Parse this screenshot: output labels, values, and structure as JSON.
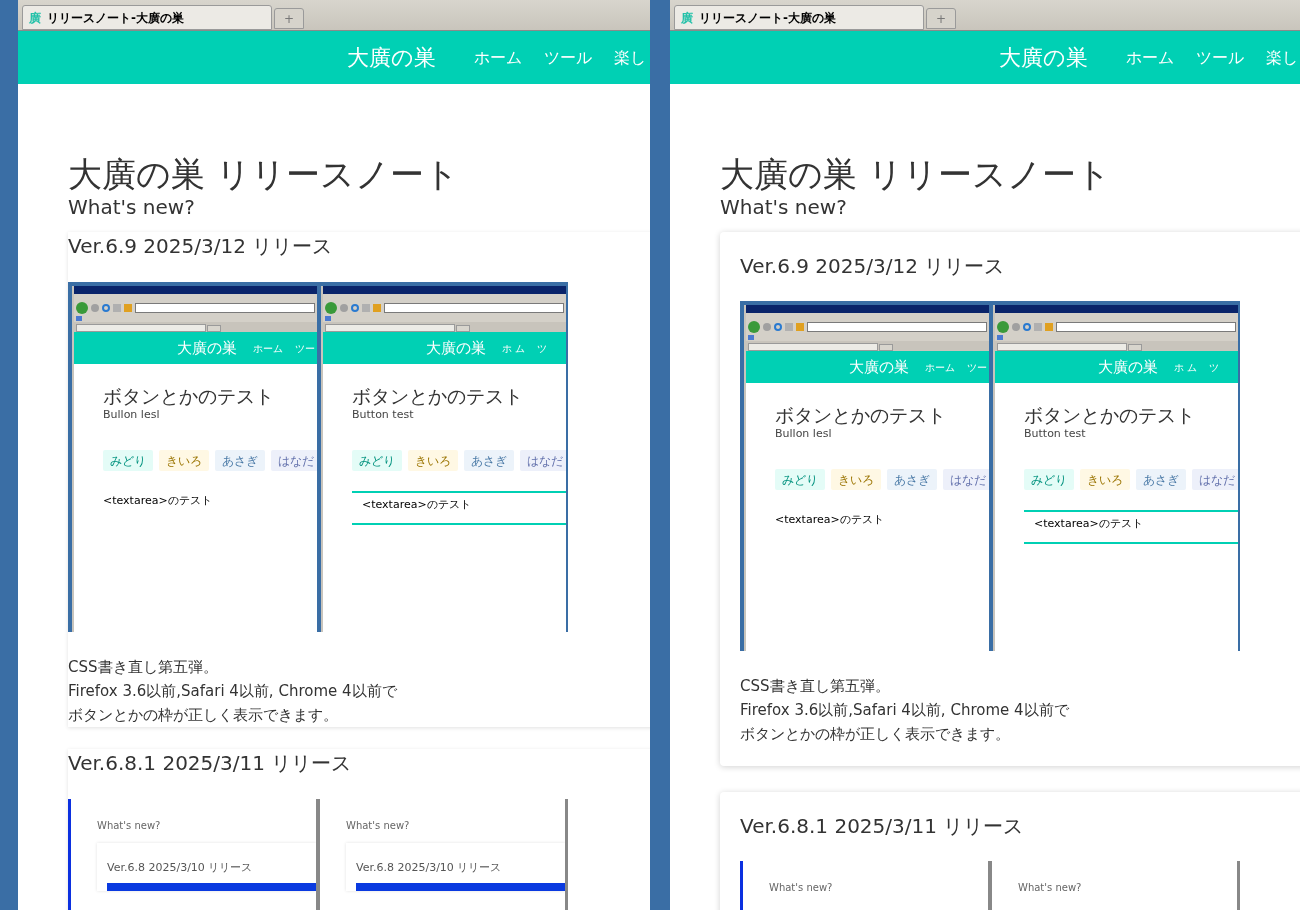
{
  "windows": [
    {
      "kind": "flush",
      "tab": {
        "icon": "廣",
        "title": "リリースノート-大廣の巣",
        "selected": true
      },
      "new_tab": "+",
      "header": {
        "site_title": "大廣の巣",
        "nav": [
          "ホーム",
          "ツール",
          "楽し"
        ]
      },
      "page": {
        "title": "大廣の巣 リリースノート",
        "subtitle": "What's new?",
        "releases": [
          {
            "heading": "Ver.6.9 2025/3/12 リリース",
            "screenshot": {
              "kind": "button-test",
              "windows": [
                {
                  "site_title": "大廣の巣",
                  "nav": [
                    "ホーム",
                    "ツー"
                  ],
                  "heading": "ボタンとかのテスト",
                  "subtitle": "Bullon lesl",
                  "buttons": [
                    {
                      "label": "みどり",
                      "color": "#e4fcf7"
                    },
                    {
                      "label": "きいろ",
                      "color": "#fff8e4"
                    },
                    {
                      "label": "あさぎ",
                      "color": "#ecf3fa"
                    },
                    {
                      "label": "はなだ",
                      "color": "#edf0fa"
                    }
                  ],
                  "textarea": {
                    "kind": "plain",
                    "text": "<textarea>のテスト"
                  }
                },
                {
                  "site_title": "大廣の巣",
                  "nav": [
                    "ホ ム",
                    "ツ"
                  ],
                  "heading": "ボタンとかのテスト",
                  "subtitle": "Button test",
                  "buttons": [
                    {
                      "label": "みどり",
                      "color": "#e4fcf7"
                    },
                    {
                      "label": "きいろ",
                      "color": "#fff8e4"
                    },
                    {
                      "label": "あさぎ",
                      "color": "#ecf3fa"
                    },
                    {
                      "label": "はなだ",
                      "color": "#edf0fa"
                    }
                  ],
                  "textarea": {
                    "kind": "field",
                    "text": "<textarea>のテスト"
                  }
                }
              ]
            },
            "notes": [
              "CSS書き直し第五弾。",
              "Firefox 3.6以前,Safari 4以前, Chrome 4以前で",
              "ボタンとかの枠が正しく表示できます。"
            ]
          },
          {
            "heading": "Ver.6.8.1 2025/3/11 リリース",
            "screenshot": {
              "kind": "release-note",
              "windows": [
                {
                  "subtitle": "What's new?",
                  "card_heading": "Ver.6.8 2025/3/10 リリース"
                },
                {
                  "subtitle": "What's new?",
                  "card_heading": "Ver.6.8 2025/3/10 リリース"
                }
              ]
            }
          }
        ]
      }
    },
    {
      "kind": "card",
      "tab": {
        "icon": "廣",
        "title": "リリースノート-大廣の巣",
        "selected": true
      },
      "new_tab": "+",
      "header": {
        "site_title": "大廣の巣",
        "nav": [
          "ホーム",
          "ツール",
          "楽し"
        ]
      },
      "page": {
        "title": "大廣の巣 リリースノート",
        "subtitle": "What's new?",
        "releases": [
          {
            "heading": "Ver.6.9 2025/3/12 リリース",
            "screenshot": {
              "kind": "button-test",
              "windows": [
                {
                  "site_title": "大廣の巣",
                  "nav": [
                    "ホーム",
                    "ツー"
                  ],
                  "heading": "ボタンとかのテスト",
                  "subtitle": "Bullon lesl",
                  "buttons": [
                    {
                      "label": "みどり",
                      "color": "#e4fcf7"
                    },
                    {
                      "label": "きいろ",
                      "color": "#fff8e4"
                    },
                    {
                      "label": "あさぎ",
                      "color": "#ecf3fa"
                    },
                    {
                      "label": "はなだ",
                      "color": "#edf0fa"
                    }
                  ],
                  "textarea": {
                    "kind": "plain",
                    "text": "<textarea>のテスト"
                  }
                },
                {
                  "site_title": "大廣の巣",
                  "nav": [
                    "ホ ム",
                    "ツ"
                  ],
                  "heading": "ボタンとかのテスト",
                  "subtitle": "Button test",
                  "buttons": [
                    {
                      "label": "みどり",
                      "color": "#e4fcf7"
                    },
                    {
                      "label": "きいろ",
                      "color": "#fff8e4"
                    },
                    {
                      "label": "あさぎ",
                      "color": "#ecf3fa"
                    },
                    {
                      "label": "はなだ",
                      "color": "#edf0fa"
                    }
                  ],
                  "textarea": {
                    "kind": "field",
                    "text": "<textarea>のテスト"
                  }
                }
              ]
            },
            "notes": [
              "CSS書き直し第五弾。",
              "Firefox 3.6以前,Safari 4以前, Chrome 4以前で",
              "ボタンとかの枠が正しく表示できます。"
            ]
          },
          {
            "heading": "Ver.6.8.1 2025/3/11 リリース",
            "screenshot": {
              "kind": "release-note",
              "windows": [
                {
                  "subtitle": "What's new?"
                },
                {
                  "subtitle": "What's new?"
                }
              ]
            }
          }
        ]
      }
    }
  ]
}
